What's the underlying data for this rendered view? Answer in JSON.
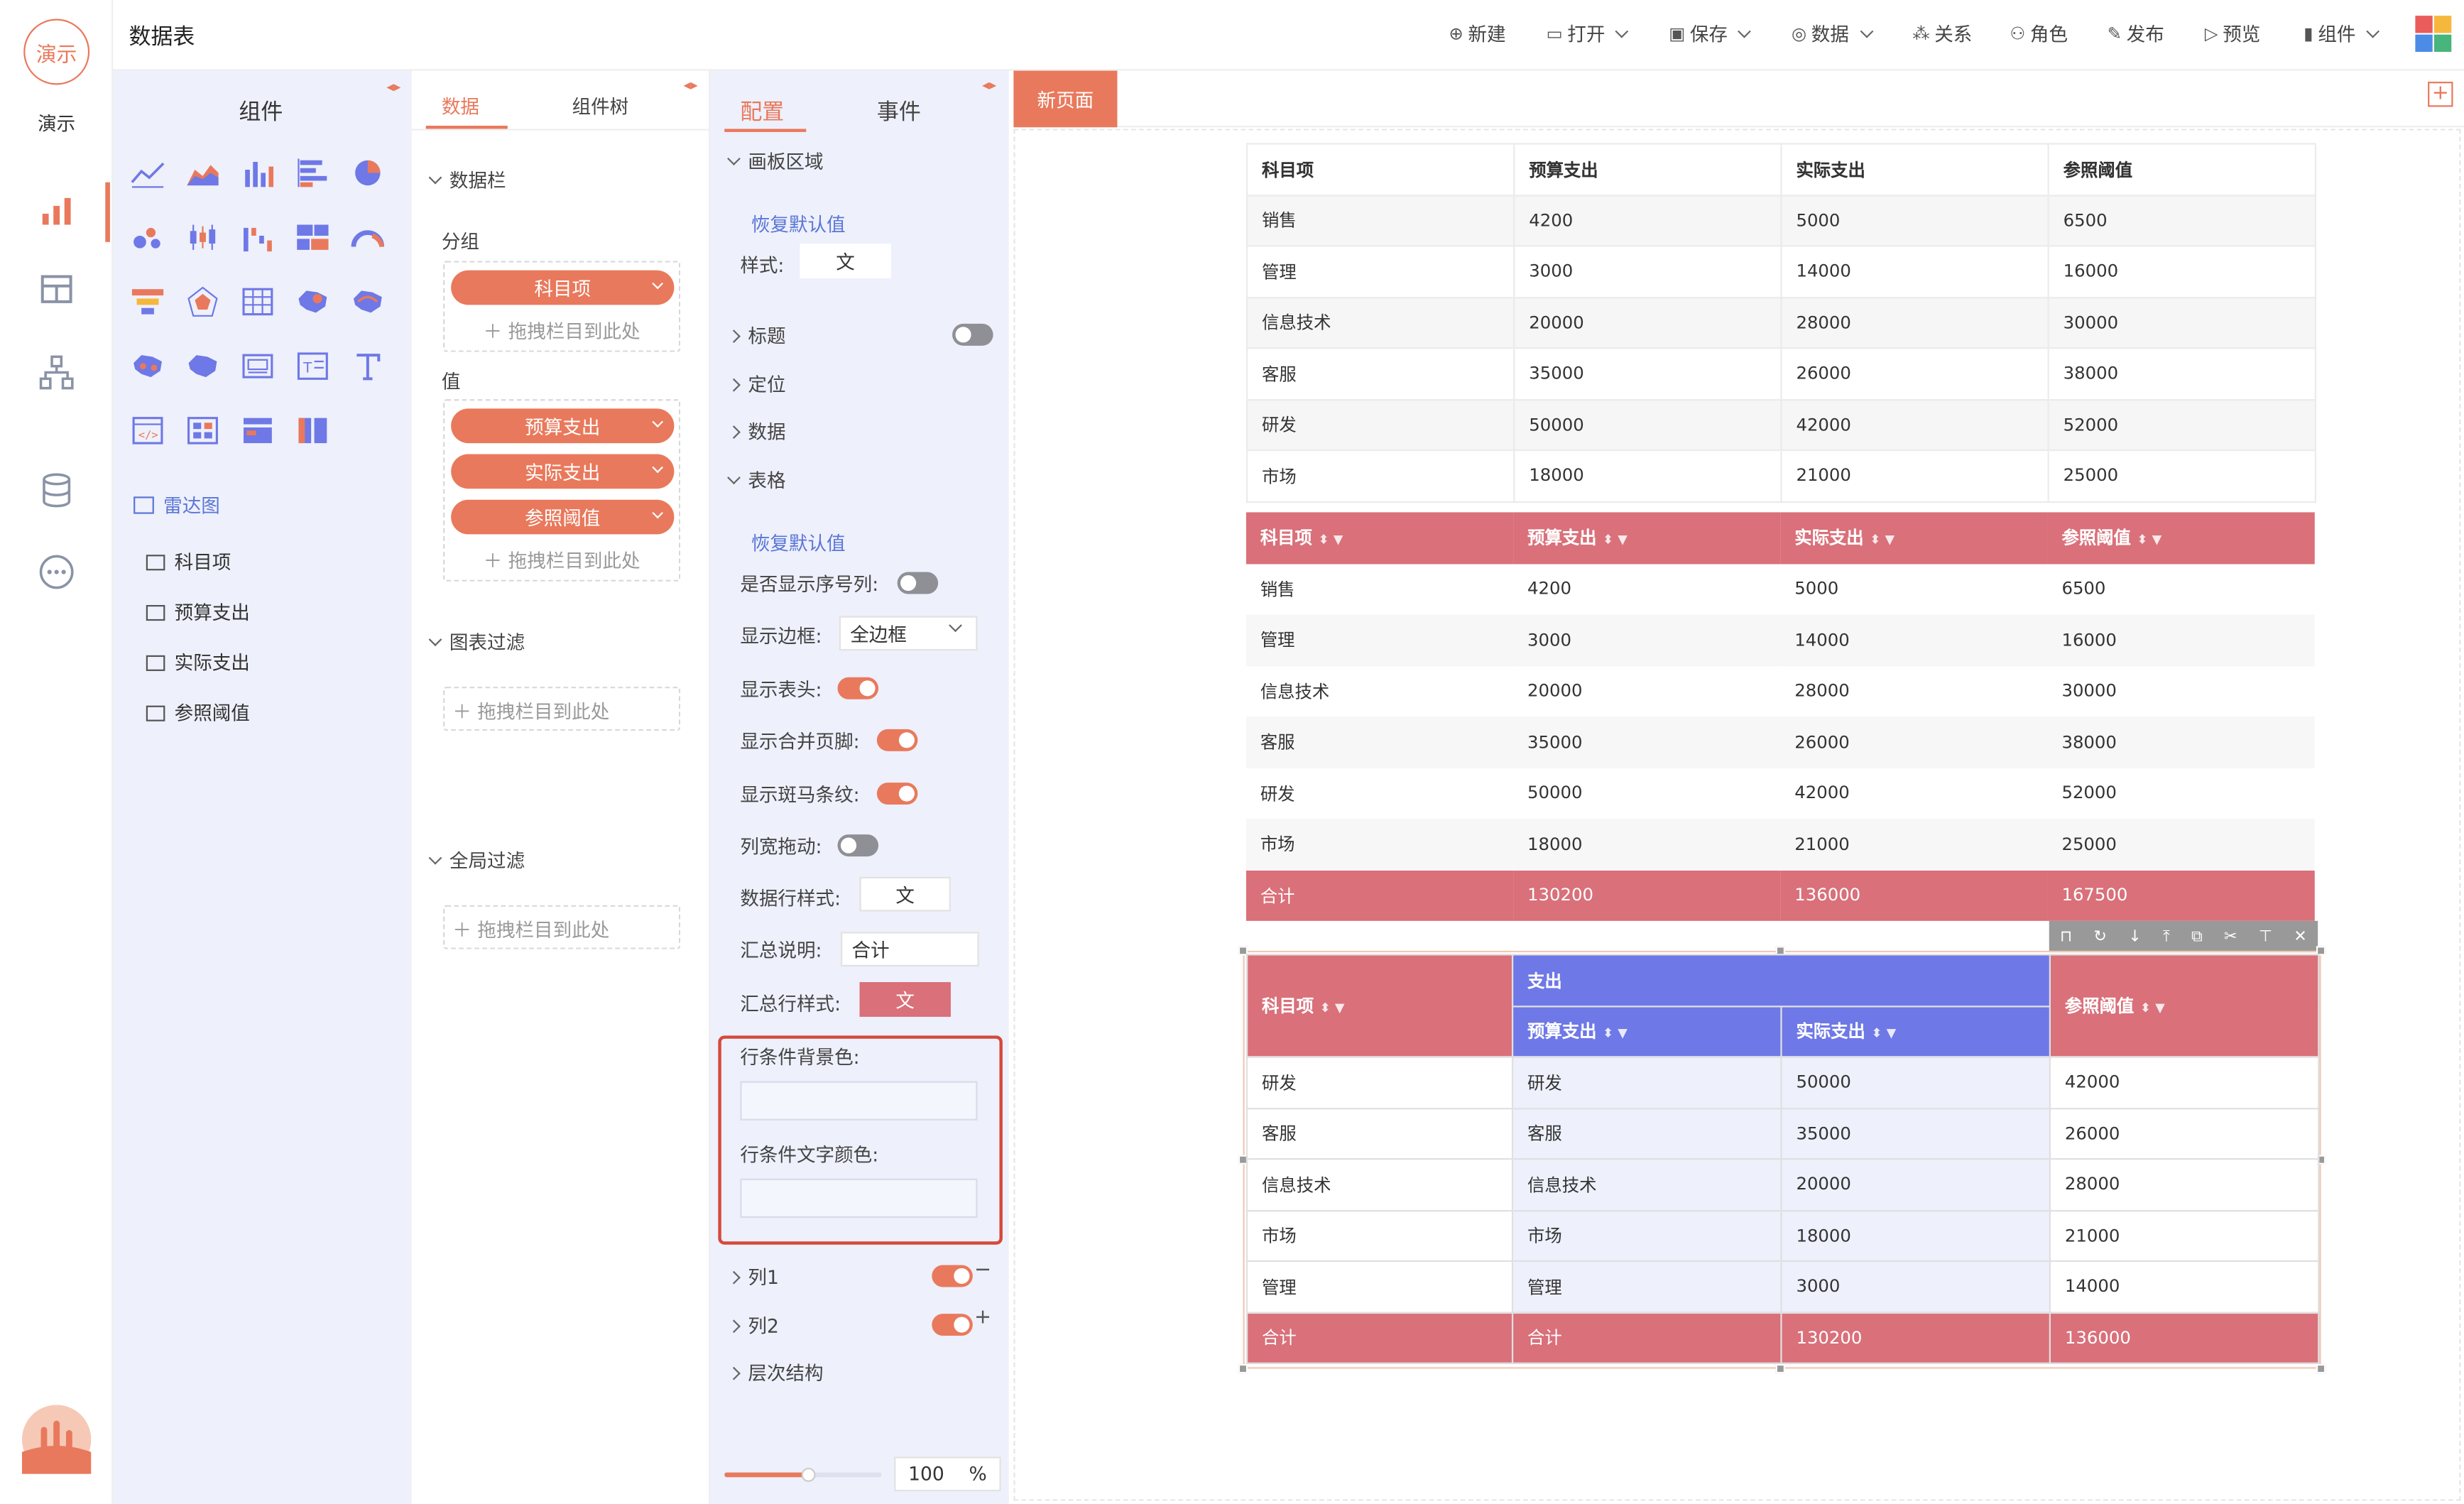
{
  "app": {
    "logo_text": "演示",
    "user_label": "演示",
    "page_title": "数据表"
  },
  "toolbar": [
    {
      "icon": "plus-circle-icon",
      "label": "新建"
    },
    {
      "icon": "folder-icon",
      "label": "打开"
    },
    {
      "icon": "save-icon",
      "label": "保存"
    },
    {
      "icon": "database-icon",
      "label": "数据"
    },
    {
      "icon": "relation-icon",
      "label": "关系"
    },
    {
      "icon": "user-icon",
      "label": "角色"
    },
    {
      "icon": "publish-icon",
      "label": "发布"
    },
    {
      "icon": "play-icon",
      "label": "预览"
    },
    {
      "icon": "bar-chart-icon",
      "label": "组件"
    }
  ],
  "components_panel": {
    "title": "组件",
    "dataset": {
      "icon": "table-icon",
      "label": "雷达图"
    },
    "fields": [
      "科目项",
      "预算支出",
      "实际支出",
      "参照阈值"
    ]
  },
  "data_panel": {
    "tabs": [
      "数据",
      "组件树"
    ],
    "section_bar": "数据栏",
    "group_label": "分组",
    "group_fields": [
      "科目项"
    ],
    "value_label": "值",
    "value_fields": [
      "预算支出",
      "实际支出",
      "参照阈值"
    ],
    "drop_hint": "拖拽栏目到此处",
    "chart_filter": "图表过滤",
    "global_filter": "全局过滤"
  },
  "config_panel": {
    "tabs": [
      "配置",
      "事件"
    ],
    "canvas_area": "画板区域",
    "reset_default": "恢复默认值",
    "style_label": "样式:",
    "style_value": "文",
    "sections": [
      "标题",
      "定位",
      "数据",
      "表格"
    ],
    "show_index": "是否显示序号列:",
    "show_border": "显示边框:",
    "border_value": "全边框",
    "show_header": "显示表头:",
    "show_footer": "显示合并页脚:",
    "show_stripe": "显示斑马条纹:",
    "col_drag": "列宽拖动:",
    "data_row_style": "数据行样式:",
    "summary_desc": "汇总说明:",
    "summary_value": "合计",
    "summary_row_style": "汇总行样式:",
    "row_cond_bg": "行条件背景色:",
    "row_cond_color": "行条件文字颜色:",
    "col1": "列1",
    "col2": "列2",
    "hierarchy": "层次结构",
    "zoom_value": "100",
    "zoom_unit": "%"
  },
  "canvas": {
    "page_tab": "新页面"
  },
  "table1": {
    "headers": [
      "科目项",
      "预算支出",
      "实际支出",
      "参照阈值"
    ],
    "rows": [
      [
        "销售",
        "4200",
        "5000",
        "6500"
      ],
      [
        "管理",
        "3000",
        "14000",
        "16000"
      ],
      [
        "信息技术",
        "20000",
        "28000",
        "30000"
      ],
      [
        "客服",
        "35000",
        "26000",
        "38000"
      ],
      [
        "研发",
        "50000",
        "42000",
        "52000"
      ],
      [
        "市场",
        "18000",
        "21000",
        "25000"
      ]
    ]
  },
  "table2": {
    "headers": [
      "科目项",
      "预算支出",
      "实际支出",
      "参照阈值"
    ],
    "rows": [
      [
        "销售",
        "4200",
        "5000",
        "6500"
      ],
      [
        "管理",
        "3000",
        "14000",
        "16000"
      ],
      [
        "信息技术",
        "20000",
        "28000",
        "30000"
      ],
      [
        "客服",
        "35000",
        "26000",
        "38000"
      ],
      [
        "研发",
        "50000",
        "42000",
        "52000"
      ],
      [
        "市场",
        "18000",
        "21000",
        "25000"
      ]
    ],
    "footer": [
      "合计",
      "130200",
      "136000",
      "167500"
    ]
  },
  "table3": {
    "group_header": "支出",
    "headers": [
      "科目项",
      "预算支出",
      "实际支出",
      "参照阈值"
    ],
    "rows": [
      [
        "研发",
        "研发",
        "50000",
        "42000"
      ],
      [
        "客服",
        "客服",
        "35000",
        "26000"
      ],
      [
        "信息技术",
        "信息技术",
        "20000",
        "28000"
      ],
      [
        "市场",
        "市场",
        "18000",
        "21000"
      ],
      [
        "管理",
        "管理",
        "3000",
        "14000"
      ]
    ],
    "footer": [
      "合计",
      "合计",
      "130200",
      "136000"
    ]
  },
  "colors": {
    "accent": "#e9795c",
    "table_red": "#d9707a",
    "table_blue": "#6e78e6",
    "panel_bg": "#eef0fb"
  }
}
